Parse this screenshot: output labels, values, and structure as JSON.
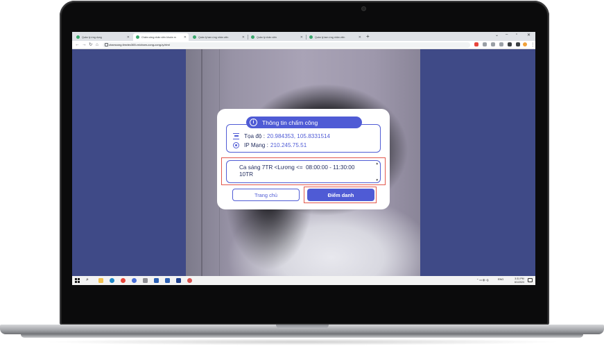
{
  "browser": {
    "tabs": [
      {
        "label": "Quản lý ứng dụng",
        "active": false
      },
      {
        "label": "Chấm công nhân viên khuôn m",
        "active": true
      },
      {
        "label": "Quản lý tam ứng nhân viên",
        "active": false
      },
      {
        "label": "Quản lý nhân viên",
        "active": false
      },
      {
        "label": "Quản lý tam ứng nhân viên",
        "active": false
      }
    ],
    "url": "chamcong.timviec365.vn/cham-cong-cong-ty.html",
    "new_tab": "+"
  },
  "modal": {
    "title": "Thông tin chấm công",
    "coord_label": "Tọa độ :",
    "coord_value": "20.984353, 105.8331514",
    "ip_label": "IP Mạng :",
    "ip_value": "210.245.75.51",
    "shift_name": "Ca sáng 7TR <Lương <= 10TR",
    "shift_time": "08:00:00 - 11:30:00",
    "home_button": "Trang chủ",
    "checkin_button": "Điểm danh"
  },
  "taskbar": {
    "language": "ENG",
    "time": "3:31 PM",
    "date": "6/1/2023"
  },
  "colors": {
    "accent": "#4f5bd5",
    "page_background": "#3f4a87",
    "highlight_outline": "#e2574c"
  }
}
